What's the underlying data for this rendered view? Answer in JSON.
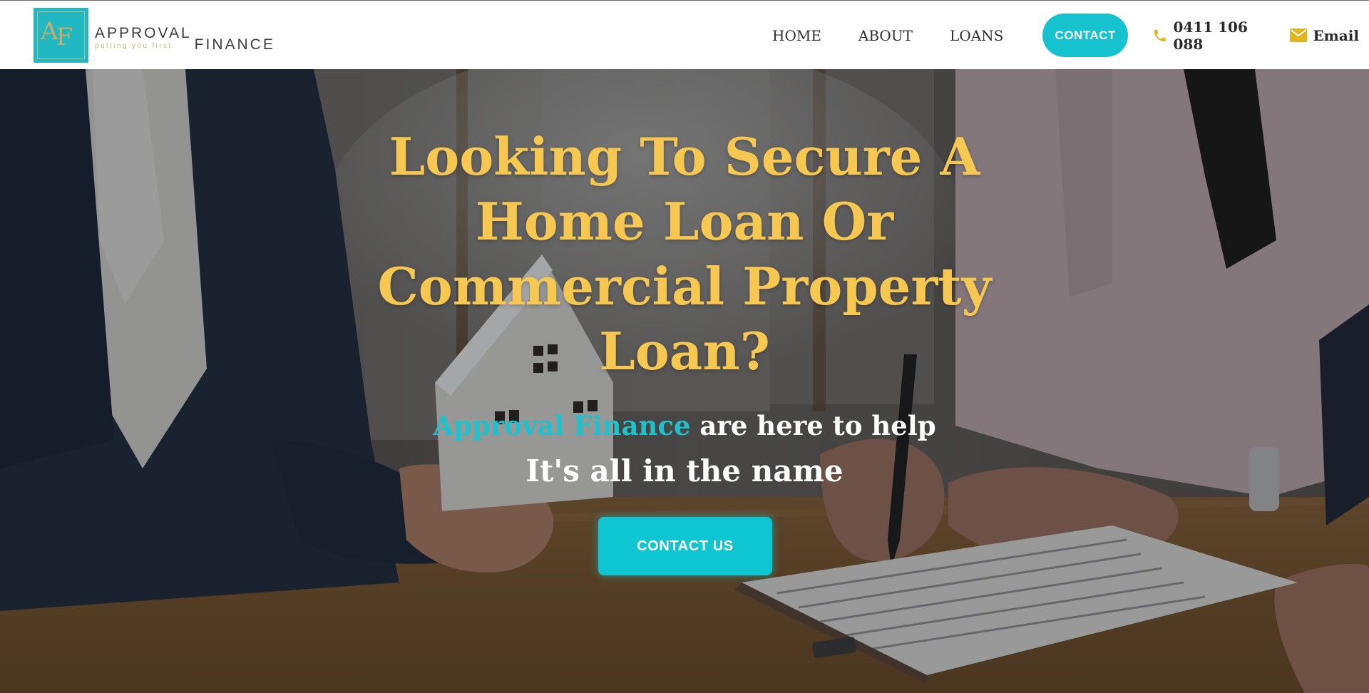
{
  "header": {
    "logo": {
      "letters": "AF",
      "word1": "APPROVAL",
      "tagline": "putting you first",
      "word2": "FINANCE"
    },
    "nav": [
      {
        "label": "HOME"
      },
      {
        "label": "ABOUT"
      },
      {
        "label": "LOANS"
      }
    ],
    "contact_button": "CONTACT",
    "phone": "0411 106 088",
    "email": "Email"
  },
  "hero": {
    "headline": "Looking To Secure A Home Loan Or Commercial Property Loan?",
    "sub_accent": "Approval Finance",
    "sub_rest": " are here to help",
    "sub2": "It's all in the name",
    "cta": "CONTACT US"
  },
  "colors": {
    "accent": "#17c2cf",
    "headline": "#f6c852",
    "brand_gold": "#cdb57a",
    "icon_gold": "#e2b41e"
  },
  "icons": {
    "phone": "phone-icon",
    "email": "envelope-icon"
  }
}
